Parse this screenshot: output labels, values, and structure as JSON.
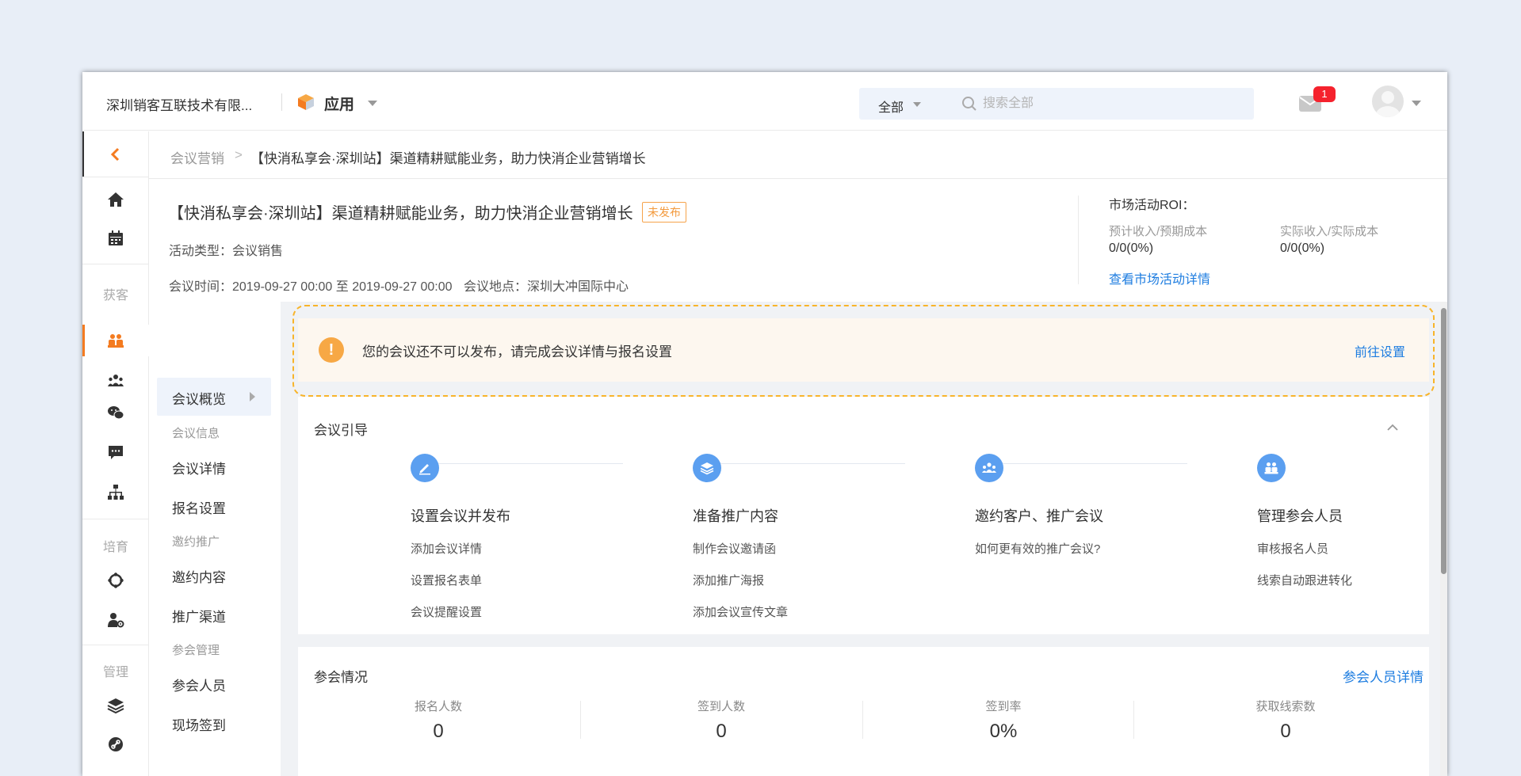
{
  "header": {
    "company": "深圳销客互联技术有限...",
    "app_title": "应用",
    "search_scope": "全部",
    "search_placeholder": "搜索全部",
    "notification_count": "1"
  },
  "rail": {
    "section_acquire": "获客",
    "section_nurture": "培育",
    "section_manage": "管理"
  },
  "breadcrumb": {
    "parent": "会议营销",
    "separator": ">",
    "current": "【快消私享会·深圳站】渠道精耕赋能业务，助力快消企业营销增长"
  },
  "activity": {
    "title": "【快消私享会·深圳站】渠道精耕赋能业务，助力快消企业营销增长",
    "status": "未发布",
    "type": "活动类型：会议销售",
    "time": "会议时间：2019-09-27 00:00 至 2019-09-27 00:00",
    "place": "会议地点：深圳大冲国际中心"
  },
  "roi": {
    "title": "市场活动ROI：",
    "label_expected": "预计收入/预期成本",
    "value_expected": "0/0(0%)",
    "label_actual": "实际收入/实际成本",
    "value_actual": "0/0(0%)",
    "detail_link": "查看市场活动详情"
  },
  "subnav": {
    "overview": "会议概览",
    "group_info": "会议信息",
    "detail": "会议详情",
    "signup": "报名设置",
    "group_invite": "邀约推广",
    "invite_content": "邀约内容",
    "channel": "推广渠道",
    "group_attendee": "参会管理",
    "attendees": "参会人员",
    "checkin": "现场签到"
  },
  "alert": {
    "text": "您的会议还不可以发布，请完成会议详情与报名设置",
    "action": "前往设置"
  },
  "guide": {
    "title": "会议引导",
    "steps": [
      {
        "name": "设置会议并发布",
        "actions": [
          "添加会议详情",
          "设置报名表单",
          "会议提醒设置"
        ]
      },
      {
        "name": "准备推广内容",
        "actions": [
          "制作会议邀请函",
          "添加推广海报",
          "添加会议宣传文章"
        ]
      },
      {
        "name": "邀约客户、推广会议",
        "actions": [
          "如何更有效的推广会议?"
        ]
      },
      {
        "name": "管理参会人员",
        "actions": [
          "审核报名人员",
          "线索自动跟进转化"
        ]
      }
    ]
  },
  "stats": {
    "title": "参会情况",
    "detail_link": "参会人员详情",
    "items": [
      {
        "label": "报名人数",
        "value": "0"
      },
      {
        "label": "签到人数",
        "value": "0"
      },
      {
        "label": "签到率",
        "value": "0%"
      },
      {
        "label": "获取线索数",
        "value": "0"
      }
    ]
  },
  "colors": {
    "accent": "#f47b20",
    "link": "#1e7de0",
    "step_icon": "#5b9ff0",
    "alert_icon": "#f7a845",
    "badge": "#f5222d"
  }
}
